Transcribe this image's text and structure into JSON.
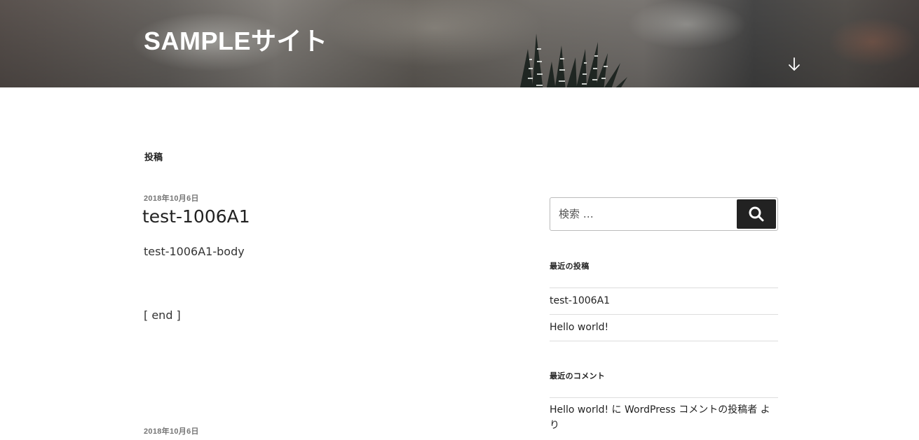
{
  "header": {
    "site_title": "SAMPLEサイト"
  },
  "page_label": "投稿",
  "posts": [
    {
      "date": "2018年10月6日",
      "title": "test-1006A1",
      "body": "test-1006A1-body",
      "end_text": "[ end ]"
    },
    {
      "date": "2018年10月6日"
    }
  ],
  "sidebar": {
    "search": {
      "placeholder": "検索 …"
    },
    "recent_posts": {
      "title": "最近の投稿",
      "items": [
        "test-1006A1",
        "Hello world!"
      ]
    },
    "recent_comments": {
      "title": "最近のコメント",
      "items": [
        {
          "post": "Hello world!",
          "connector": " に ",
          "author": "WordPress コメントの投稿者",
          "suffix": " より"
        }
      ]
    }
  },
  "colors": {
    "text": "#333333",
    "heading": "#222222",
    "search_button_bg": "#222222",
    "divider": "#dddddd"
  }
}
